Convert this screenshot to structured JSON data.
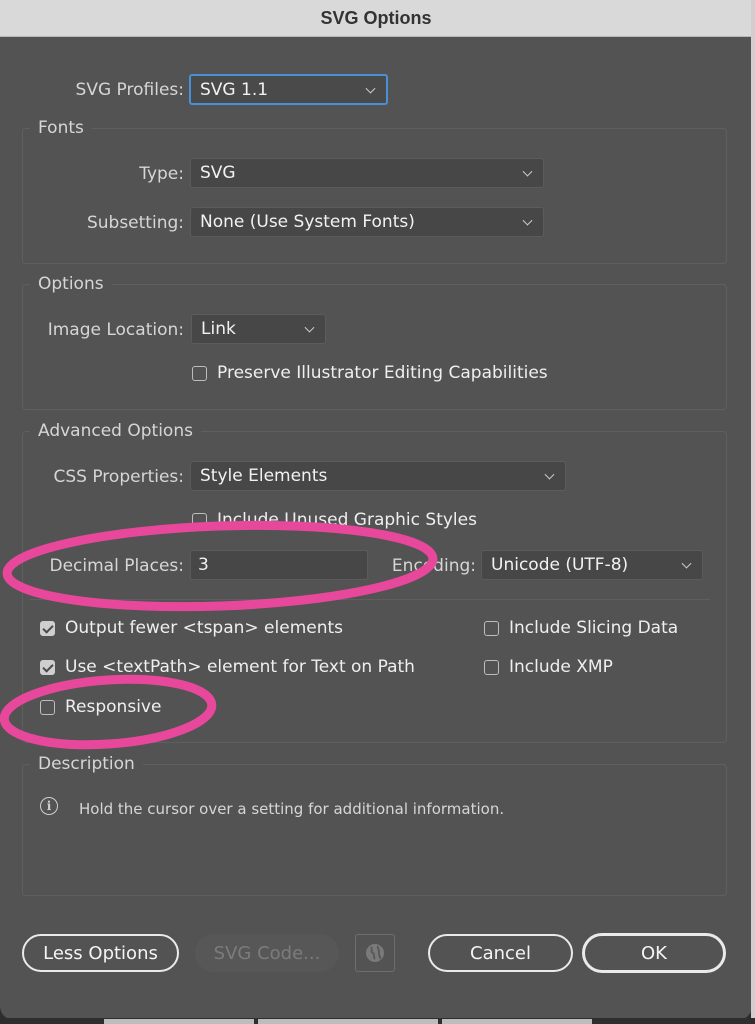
{
  "window": {
    "title": "SVG Options"
  },
  "profiles": {
    "label": "SVG Profiles:",
    "value": "SVG 1.1"
  },
  "fonts": {
    "section_title": "Fonts",
    "type": {
      "label": "Type:",
      "value": "SVG"
    },
    "subsetting": {
      "label": "Subsetting:",
      "value": "None (Use System Fonts)"
    }
  },
  "options": {
    "section_title": "Options",
    "image_location": {
      "label": "Image Location:",
      "value": "Link"
    },
    "preserve_editing": {
      "label": "Preserve Illustrator Editing Capabilities",
      "checked": false
    }
  },
  "advanced": {
    "section_title": "Advanced Options",
    "css_properties": {
      "label": "CSS Properties:",
      "value": "Style Elements"
    },
    "include_unused_styles": {
      "label": "Include Unused Graphic Styles",
      "checked": false
    },
    "decimal_places": {
      "label": "Decimal Places:",
      "value": "3"
    },
    "encoding": {
      "label": "Encoding:",
      "value": "Unicode (UTF-8)"
    },
    "output_fewer_tspan": {
      "label": "Output fewer <tspan> elements",
      "checked": true
    },
    "use_textpath": {
      "label": "Use <textPath> element for Text on Path",
      "checked": true
    },
    "responsive": {
      "label": "Responsive",
      "checked": false
    },
    "include_slicing": {
      "label": "Include Slicing Data",
      "checked": false
    },
    "include_xmp": {
      "label": "Include XMP",
      "checked": false
    }
  },
  "description": {
    "section_title": "Description",
    "icon": "info-icon",
    "text": "Hold the cursor over a setting for additional information."
  },
  "buttons": {
    "less_options": "Less Options",
    "svg_code": "SVG Code...",
    "globe_icon": "globe-icon",
    "cancel": "Cancel",
    "ok": "OK"
  },
  "annotation": {
    "color": "#e8489b"
  }
}
